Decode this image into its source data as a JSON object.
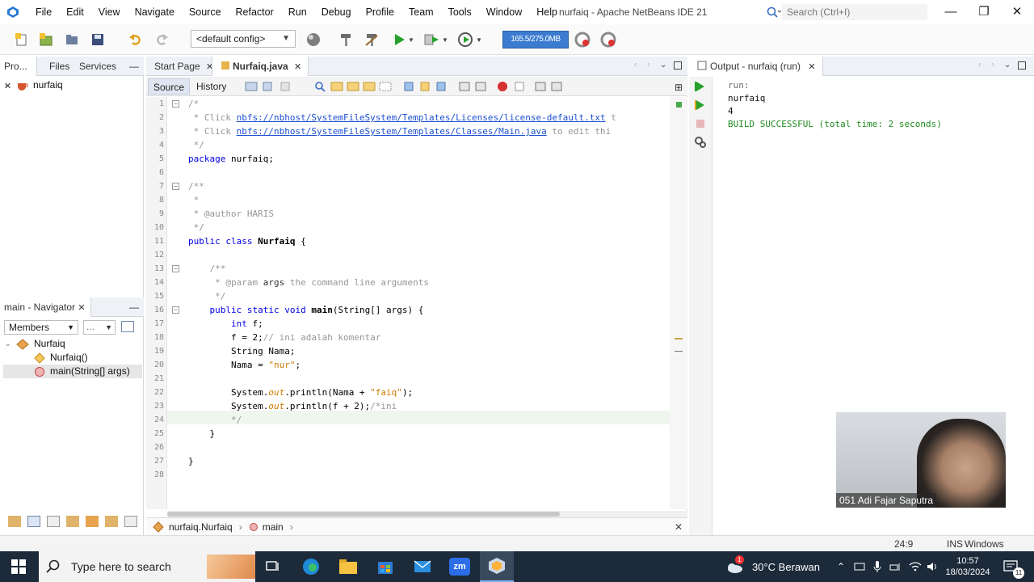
{
  "window": {
    "title": "nurfaiq - Apache NetBeans IDE 21",
    "search_placeholder": "Search (Ctrl+I)"
  },
  "menu": [
    "File",
    "Edit",
    "View",
    "Navigate",
    "Source",
    "Refactor",
    "Run",
    "Debug",
    "Profile",
    "Team",
    "Tools",
    "Window",
    "Help"
  ],
  "toolbar": {
    "config": "<default config>",
    "memory": "165.5/275.0MB"
  },
  "projects_pane": {
    "tabs": [
      "Pro...",
      "Files",
      "Services"
    ],
    "tree": [
      "nurfaiq"
    ]
  },
  "navigator": {
    "title": "main - Navigator",
    "filter": "Members",
    "extra": "...",
    "tree": [
      "Nurfaiq",
      "Nurfaiq()",
      "main(String[] args)"
    ]
  },
  "editor": {
    "tabs": [
      "Start Page",
      "Nurfaiq.java"
    ],
    "subtabs": [
      "Source",
      "History"
    ],
    "breadcrumb": [
      "nurfaiq.Nurfaiq",
      "main"
    ],
    "line_numbers": [
      "1",
      "2",
      "3",
      "4",
      "5",
      "6",
      "7",
      "8",
      "9",
      "10",
      "11",
      "12",
      "13",
      "14",
      "15",
      "16",
      "17",
      "18",
      "19",
      "20",
      "21",
      "22",
      "23",
      "24",
      "25",
      "26",
      "27",
      "28"
    ],
    "code": {
      "l1": "/*",
      "l2a": " * Click ",
      "l2b": "nbfs://nbhost/SystemFileSystem/Templates/Licenses/license-default.txt",
      "l2c": " t",
      "l3a": " * Click ",
      "l3b": "nbfs://nbhost/SystemFileSystem/Templates/Classes/Main.java",
      "l3c": " to edit thi",
      "l4": " */",
      "l5a": "package",
      "l5b": " nurfaiq;",
      "l7": "/**",
      "l8": " *",
      "l9": " * @author HARIS",
      "l10": " */",
      "l11a": "public class ",
      "l11b": "Nurfaiq",
      "l11c": " {",
      "l13": "    /**",
      "l14a": "     * @param ",
      "l14b": "args",
      "l14c": " the command line arguments",
      "l15": "     */",
      "l16a": "    public static void ",
      "l16b": "main",
      "l16c": "(String[] args) {",
      "l17a": "        int",
      "l17b": " f;",
      "l18a": "        f = 2;",
      "l18b": "// ini adalah komentar",
      "l19": "        String Nama;",
      "l20a": "        Nama = ",
      "l20b": "\"nur\"",
      "l20c": ";",
      "l22a": "        System.",
      "l22b": "out",
      "l22c": ".println(Nama + ",
      "l22d": "\"faiq\"",
      "l22e": ");",
      "l23a": "        System.",
      "l23b": "out",
      "l23c": ".println(f + 2);",
      "l23d": "/*ini",
      "l24": "        */",
      "l25": "    }",
      "l27": "}"
    }
  },
  "output": {
    "tab": "Output - nurfaiq (run)",
    "lines": [
      "run:",
      "nurfaiq",
      "4",
      "BUILD SUCCESSFUL (total time: 2 seconds)"
    ]
  },
  "webcam": {
    "label": "051 Adi Fajar Saputra"
  },
  "status": {
    "position": "24:9",
    "mode": "INS",
    "line_ending": "Windows (CRLF)"
  },
  "taskbar": {
    "search": "Type here to search",
    "weather": "30°C Berawan",
    "time": "10:57",
    "date": "18/03/2024",
    "notifications": "11",
    "zoom": "zm",
    "weather_badge": "1"
  },
  "colors": {
    "accent": "#3b7bd0",
    "build_success": "#1f8a1f",
    "taskbar": "#1c2a3a"
  }
}
